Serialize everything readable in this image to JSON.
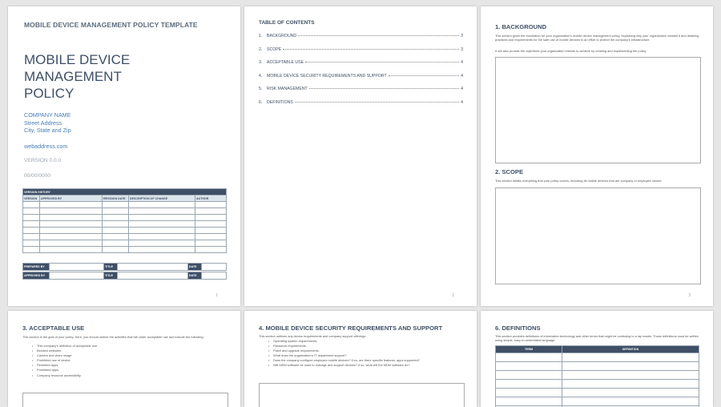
{
  "cover": {
    "header": "MOBILE DEVICE MANAGEMENT POLICY TEMPLATE",
    "title_lines": [
      "MOBILE DEVICE",
      "MANAGEMENT",
      "POLICY"
    ],
    "company_name": "COMPANY NAME",
    "street": "Street Address",
    "city": "City, State and Zip",
    "web": "webaddress.com",
    "version": "VERSION 0.0.0",
    "date": "00/00/0000",
    "version_history": {
      "caption": "VERSION HISTORY",
      "headers": [
        "VERSION",
        "APPROVED BY",
        "REVISION DATE",
        "DESCRIPTION OF CHANGE",
        "AUTHOR"
      ]
    },
    "signoff": {
      "prepared_by": "PREPARED BY",
      "approved_by": "APPROVED BY",
      "title": "TITLE",
      "date": "DATE"
    },
    "page_number": "1"
  },
  "toc": {
    "title": "TABLE OF CONTENTS",
    "entries": [
      {
        "num": "1.",
        "label": "BACKGROUND",
        "page": "3"
      },
      {
        "num": "2.",
        "label": "SCOPE",
        "page": "3"
      },
      {
        "num": "3.",
        "label": "ACCEPTABLE USE",
        "page": "4"
      },
      {
        "num": "4.",
        "label": "MOBILE DEVICE SECURITY REQUIREMENTS AND SUPPORT",
        "page": "4"
      },
      {
        "num": "5.",
        "label": "RISK MANAGEMENT",
        "page": "4"
      },
      {
        "num": "6.",
        "label": "DEFINITIONS",
        "page": "4"
      }
    ],
    "page_number": "2"
  },
  "page3": {
    "background_title": "1.  BACKGROUND",
    "background_text": "This section gives the foundation for your organization's mobile device management policy, explaining why your organization created it and detailing practices and requirements for the safe use of mobile devices in an effort to protect the company's infrastructure.",
    "background_text2": "It will also provide the objectives your organization intends to achieve by creating and implementing the policy.",
    "scope_title": "2.  SCOPE",
    "scope_text": "This section details everything that your policy covers, including all mobile devices that are company or employee owned.",
    "page_number": "3"
  },
  "page4": {
    "title": "3.  ACCEPTABLE USE",
    "text": "This section is the guts of your policy. Here, you should outline the activities that fall under acceptable use and include the following:",
    "bullets": [
      "This company's definition of acceptable use.",
      "Blocked websites.",
      "Camera and video usage.",
      "Prohibited use of device.",
      "Permitted apps.",
      "Prohibited apps.",
      "Company resource accessibility."
    ]
  },
  "page5": {
    "title": "4.  MOBILE DEVICE SECURITY REQUIREMENTS AND SUPPORT",
    "text": "This section outlines any device requirements and company support offerings.",
    "bullets": [
      "Operating system requirements.",
      "Password requirements.",
      "Patch and upgrade requirements.",
      "What does the organization's IT department support?",
      "Does the company configure employee mobile devices? If so, are there specific features, apps supported?",
      "Will MDM software be used to manage and support devices? If so, what will the MDM software do?"
    ]
  },
  "page6": {
    "title": "6.  DEFINITIONS",
    "text": "This section provides definitions of information technology and other terms that might be confusing to a lay reader. Those definitions must be written using simple, easy-to-understand language.",
    "headers": [
      "TERM",
      "DEFINITION"
    ]
  }
}
